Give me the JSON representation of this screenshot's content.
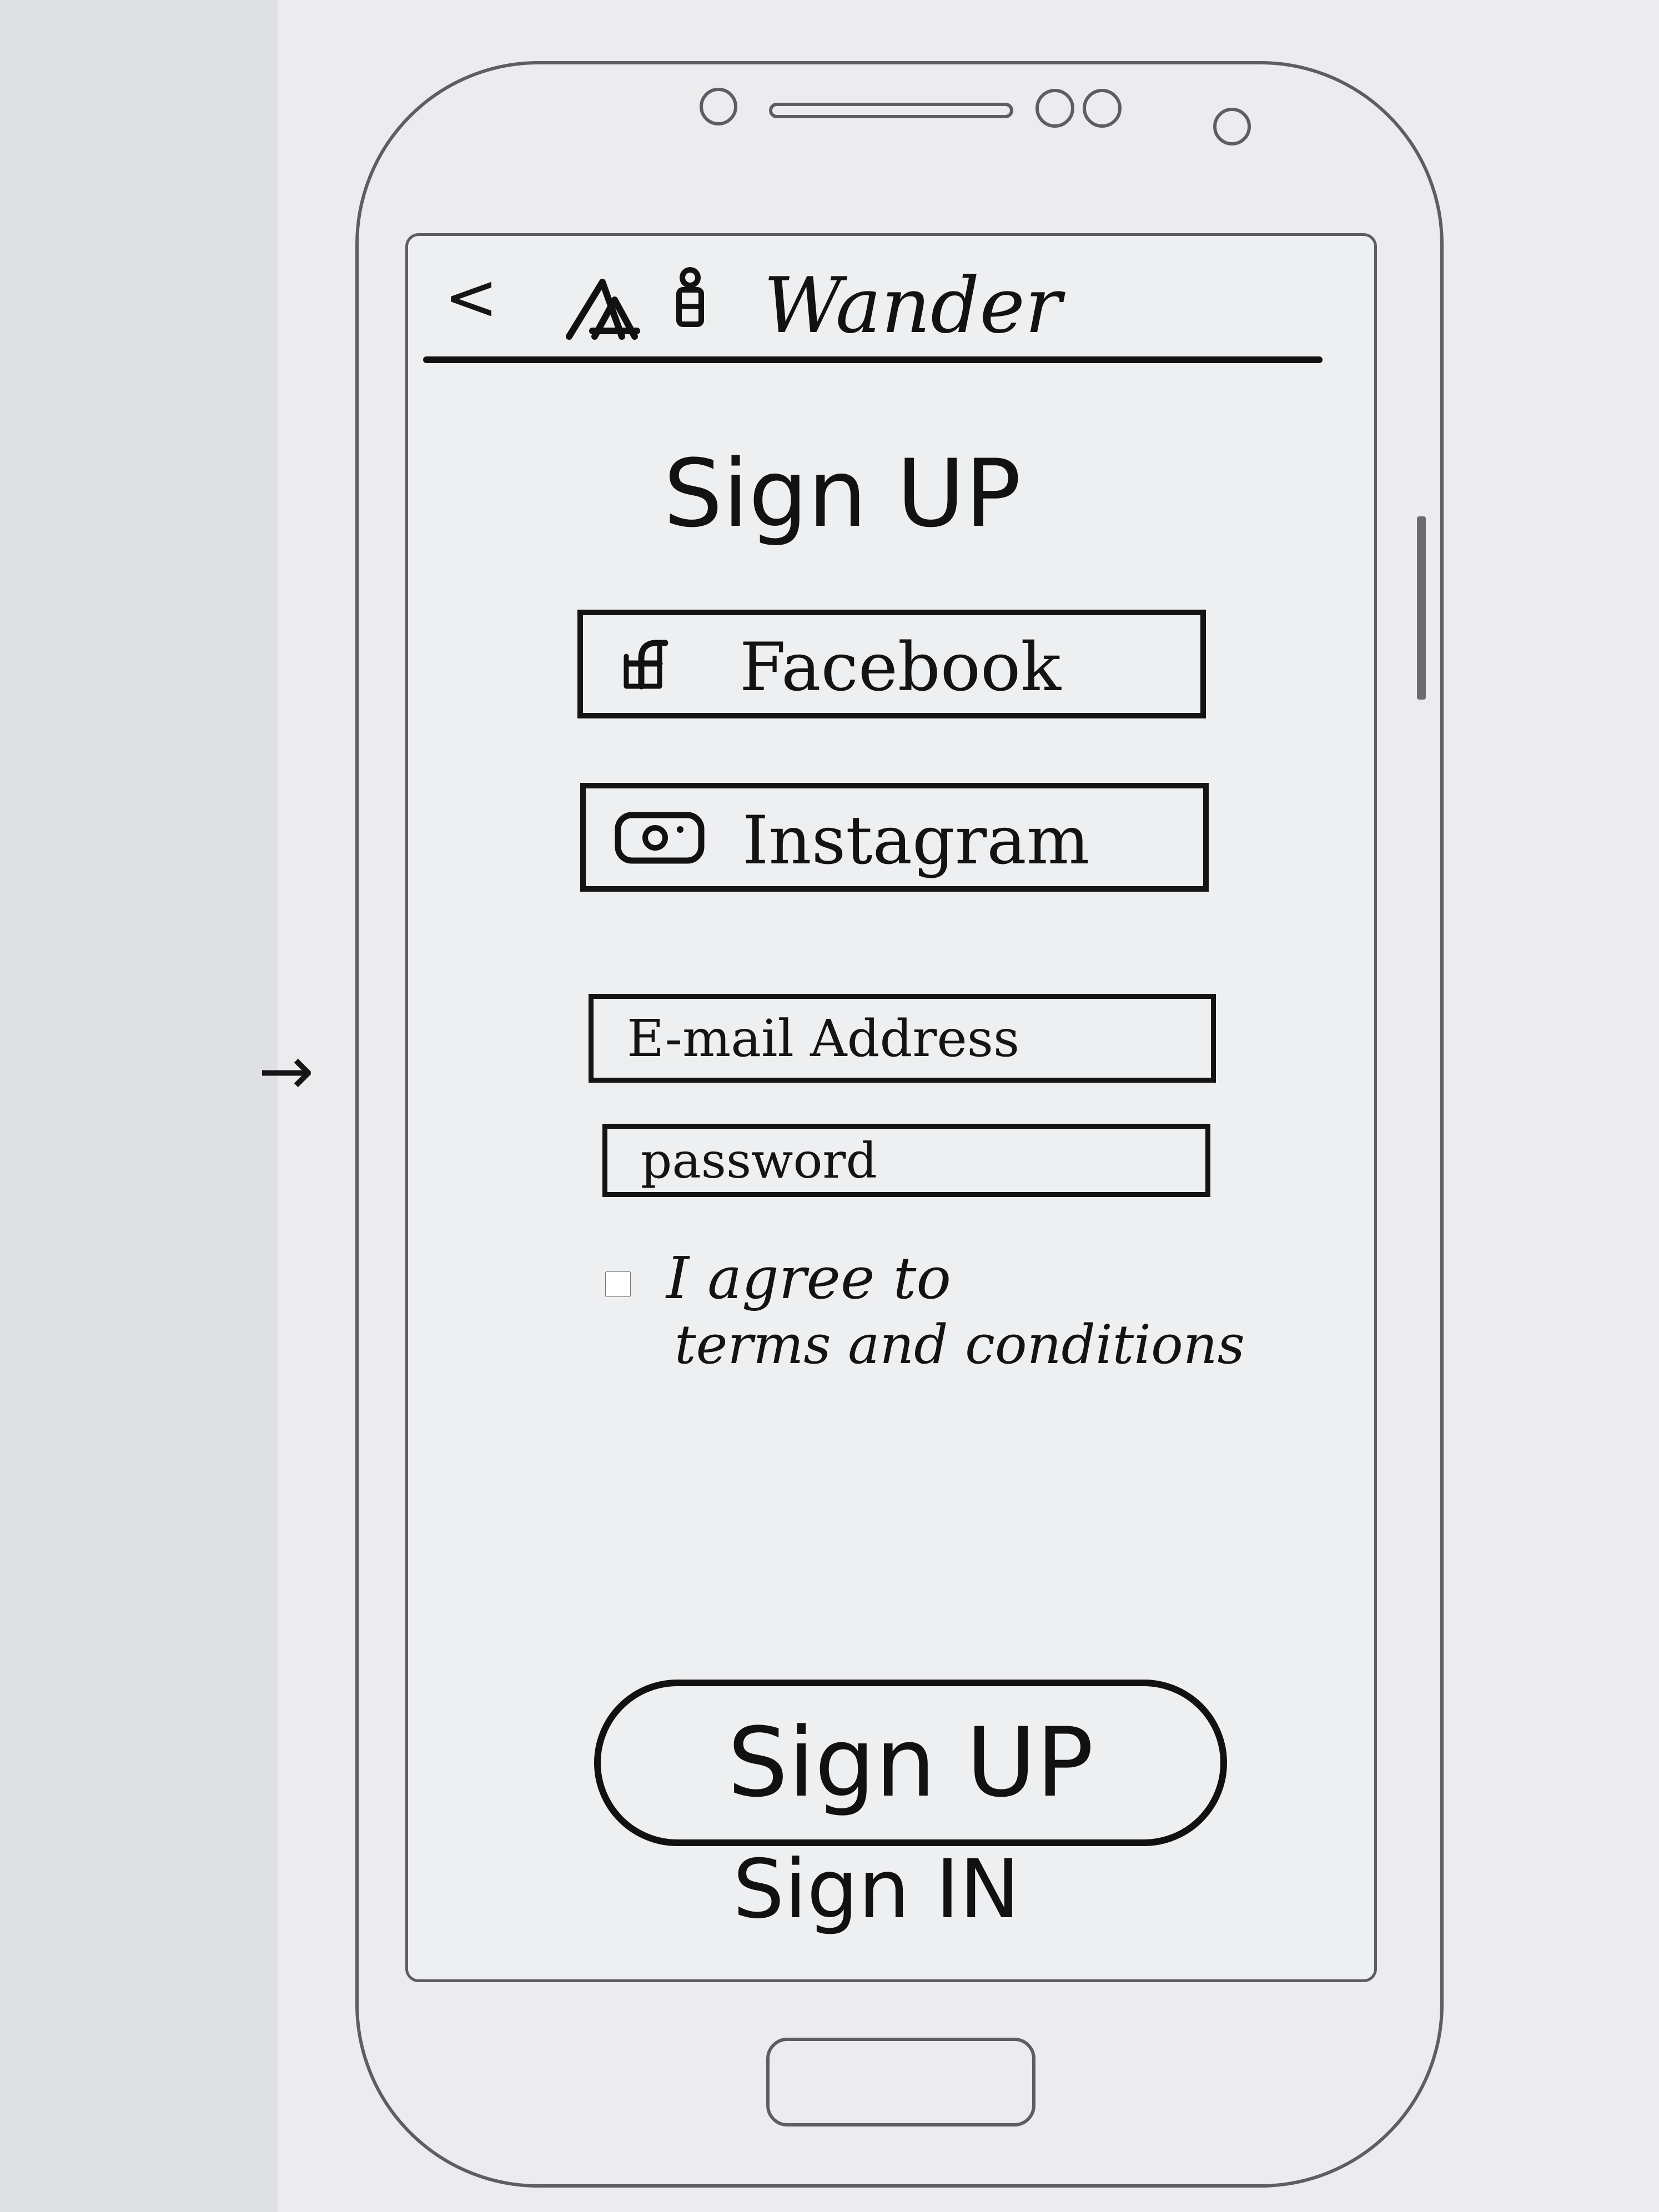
{
  "app_bar": {
    "back_icon": "chevron-left-icon",
    "logo_icon": "mountain-traveler-logo-icon",
    "title": "Wander"
  },
  "screen": {
    "title": "Sign UP"
  },
  "social": {
    "facebook_label": "Facebook",
    "facebook_icon": "facebook-icon",
    "instagram_label": "Instagram",
    "instagram_icon": "instagram-icon"
  },
  "form": {
    "email_placeholder": "E-mail Address",
    "password_placeholder": "password",
    "agree_line_1": "I agree to",
    "agree_line_2": "terms and conditions"
  },
  "actions": {
    "primary_label": "Sign UP",
    "secondary_label": "Sign IN"
  }
}
